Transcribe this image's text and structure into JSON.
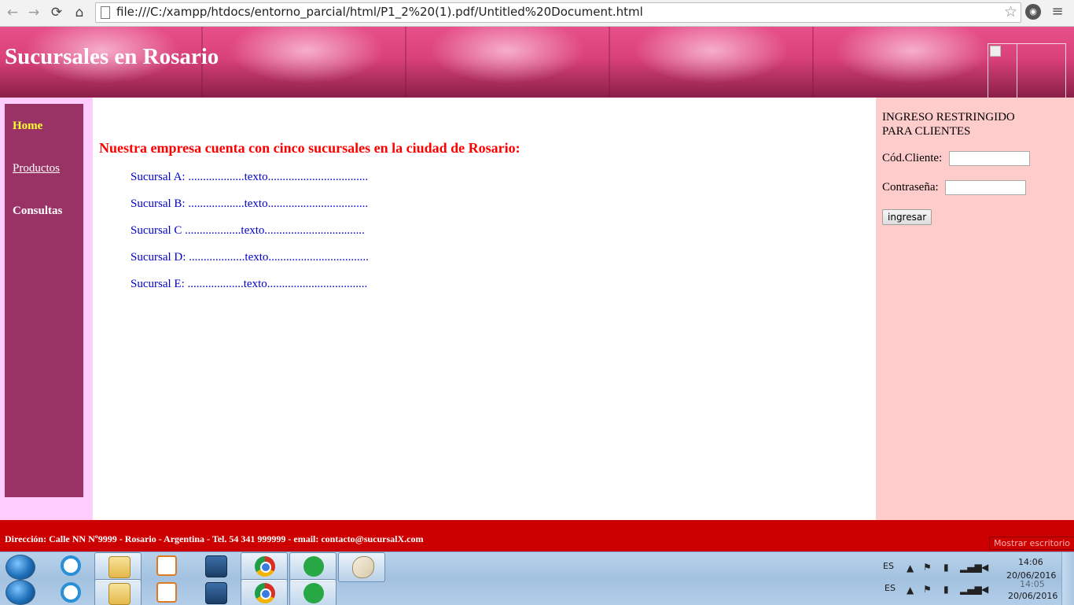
{
  "browser": {
    "back_icon": "←",
    "forward_icon": "→",
    "reload_icon": "⟳",
    "home_icon": "⌂",
    "url": "file:///C:/xampp/htdocs/entorno_parcial/html/P1_2%20(1).pdf/Untitled%20Document.html",
    "star_icon": "☆",
    "menu_icon": "≡"
  },
  "header": {
    "title": "Sucursales en Rosario"
  },
  "sidebar": {
    "items": [
      {
        "label": "Home"
      },
      {
        "label": "Productos"
      },
      {
        "label": "Consultas"
      }
    ]
  },
  "main": {
    "heading": "Nuestra empresa cuenta con cinco sucursales en la ciudad de Rosario:",
    "branches": [
      "Sucursal A: ...................texto..................................",
      "Sucursal B: ...................texto..................................",
      "Sucursal C ...................texto..................................",
      "Sucursal D: ...................texto..................................",
      "Sucursal E: ...................texto.................................."
    ]
  },
  "login": {
    "title": "INGRESO RESTRINGIDO PARA CLIENTES",
    "client_code_label": "Cód.Cliente:",
    "client_code_value": "",
    "password_label": "Contraseña:",
    "password_value": "",
    "submit_label": "ingresar"
  },
  "footer": {
    "text": "Dirección: Calle NN Nº9999 - Rosario - Argentina - Tel. 54 341 999999 - email: contacto@sucursalX.com",
    "tooltip": "Mostrar escritorio"
  },
  "taskbar": {
    "language": "ES",
    "time": "14:06",
    "date": "20/06/2016",
    "ghost_time": "14:05",
    "ghost_date": "20/06/2016",
    "apps": [
      "internet-explorer",
      "file-explorer",
      "media-player",
      "briefcase",
      "chrome",
      "whatsapp",
      "paint"
    ]
  },
  "colors": {
    "sidebar": "#993366",
    "sidebar_bg": "#ffccff",
    "home_link": "#ffff33",
    "heading": "#ff0000",
    "branch_text": "#0000cc",
    "login_bg": "#ffcccc",
    "footer_bg": "#cc0000"
  }
}
